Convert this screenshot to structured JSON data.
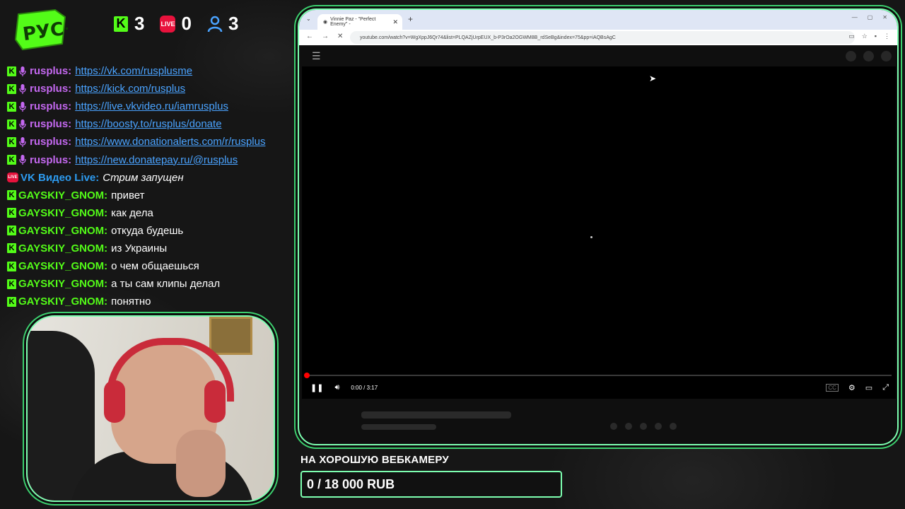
{
  "logo": {
    "alt": "РУС+"
  },
  "stats": {
    "kick_viewers": "3",
    "vk_live_viewers": "0",
    "total_viewers": "3"
  },
  "chat": [
    {
      "source": "kick",
      "mod": true,
      "user": "rusplus:",
      "text": "https://vk.com/rusplusme",
      "type": "link",
      "color": "purple"
    },
    {
      "source": "kick",
      "mod": true,
      "user": "rusplus:",
      "text": "https://kick.com/rusplus",
      "type": "link",
      "color": "purple"
    },
    {
      "source": "kick",
      "mod": true,
      "user": "rusplus:",
      "text": "https://live.vkvideo.ru/iamrusplus",
      "type": "link",
      "color": "purple"
    },
    {
      "source": "kick",
      "mod": true,
      "user": "rusplus:",
      "text": "https://boosty.to/rusplus/donate",
      "type": "link",
      "color": "purple"
    },
    {
      "source": "kick",
      "mod": true,
      "user": "rusplus:",
      "text": "https://www.donationalerts.com/r/rusplus",
      "type": "link",
      "color": "purple"
    },
    {
      "source": "kick",
      "mod": true,
      "user": "rusplus:",
      "text": "https://new.donatepay.ru/@rusplus",
      "type": "link",
      "color": "purple"
    },
    {
      "source": "vk",
      "mod": false,
      "user": "VK Видео Live:",
      "text": "Стрим запущен",
      "type": "italic",
      "color": "blue"
    },
    {
      "source": "kick",
      "mod": false,
      "user": "GAYSKIY_GNOM:",
      "text": "привет",
      "type": "text",
      "color": "green"
    },
    {
      "source": "kick",
      "mod": false,
      "user": "GAYSKIY_GNOM:",
      "text": "как дела",
      "type": "text",
      "color": "green"
    },
    {
      "source": "kick",
      "mod": false,
      "user": "GAYSKIY_GNOM:",
      "text": "откуда будешь",
      "type": "text",
      "color": "green"
    },
    {
      "source": "kick",
      "mod": false,
      "user": "GAYSKIY_GNOM:",
      "text": "из Украины",
      "type": "text",
      "color": "green"
    },
    {
      "source": "kick",
      "mod": false,
      "user": "GAYSKIY_GNOM:",
      "text": "о чем общаешься",
      "type": "text",
      "color": "green"
    },
    {
      "source": "kick",
      "mod": false,
      "user": "GAYSKIY_GNOM:",
      "text": "а ты сам клипы делал",
      "type": "text",
      "color": "green"
    },
    {
      "source": "kick",
      "mod": false,
      "user": "GAYSKIY_GNOM:",
      "text": "понятно",
      "type": "text",
      "color": "green"
    }
  ],
  "browser": {
    "tab_title": "Vinnie Paz - \"Perfect Enemy\" -",
    "url": "youtube.com/watch?v=WgXppJ6Qr74&list=PLQAZjUrpEUX_b-P3rOa2OGWM8B_rdSeBg&index=75&pp=iAQBsAgC",
    "player": {
      "time": "0:00 / 3:17",
      "progress": 0
    }
  },
  "goal": {
    "title": "НА ХОРОШУЮ ВЕБКАМЕРУ",
    "amount": "0 / 18 000 RUB",
    "progress": 0
  },
  "colors": {
    "accent_green": "#53fc18",
    "frame_mint": "#7dffb0",
    "live_red": "#e8123c",
    "link_blue": "#4aa3ff",
    "mod_purple": "#c468f0"
  },
  "icons": {
    "kick": "kick-icon",
    "vk_live": "vk-live-icon",
    "viewers": "person-icon",
    "mic": "microphone-icon"
  }
}
